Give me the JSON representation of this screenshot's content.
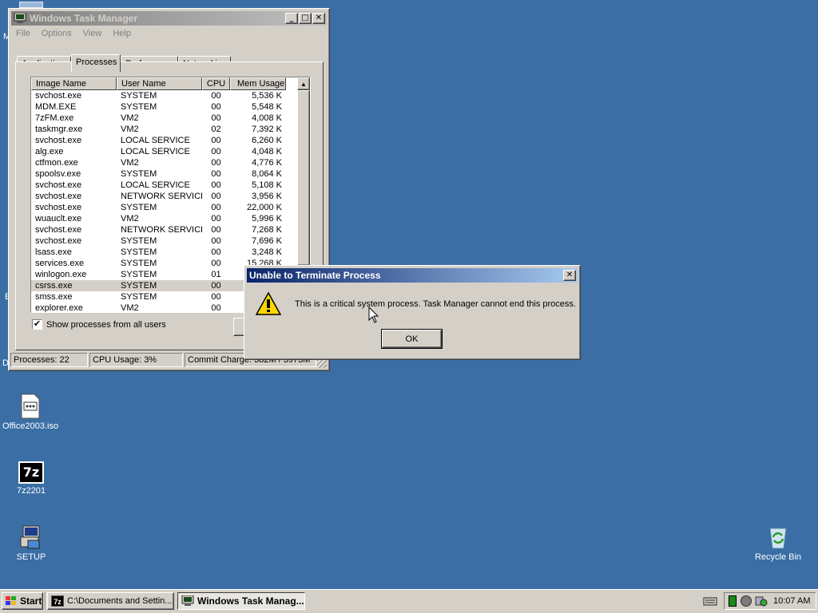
{
  "desktop": {
    "icons": [
      {
        "label": "Office2003.iso",
        "icon": "disc-image-icon"
      },
      {
        "label": "7z2201",
        "icon": "7zip-icon"
      },
      {
        "label": "SETUP",
        "icon": "setup-icon"
      },
      {
        "label": "Recycle Bin",
        "icon": "recycle-bin-icon"
      }
    ],
    "background": "#3a6ea5"
  },
  "task_manager": {
    "title": "Windows Task Manager",
    "menu": [
      "File",
      "Options",
      "View",
      "Help"
    ],
    "tabs": [
      "Applications",
      "Processes",
      "Performance",
      "Networking"
    ],
    "selected_tab": "Processes",
    "columns": [
      "Image Name",
      "User Name",
      "CPU",
      "Mem Usage"
    ],
    "rows": [
      [
        "svchost.exe",
        "SYSTEM",
        "00",
        "5,536 K"
      ],
      [
        "MDM.EXE",
        "SYSTEM",
        "00",
        "5,548 K"
      ],
      [
        "7zFM.exe",
        "VM2",
        "00",
        "4,008 K"
      ],
      [
        "taskmgr.exe",
        "VM2",
        "02",
        "7,392 K"
      ],
      [
        "svchost.exe",
        "LOCAL SERVICE",
        "00",
        "6,260 K"
      ],
      [
        "alg.exe",
        "LOCAL SERVICE",
        "00",
        "4,048 K"
      ],
      [
        "ctfmon.exe",
        "VM2",
        "00",
        "4,776 K"
      ],
      [
        "spoolsv.exe",
        "SYSTEM",
        "00",
        "8,064 K"
      ],
      [
        "svchost.exe",
        "LOCAL SERVICE",
        "00",
        "5,108 K"
      ],
      [
        "svchost.exe",
        "NETWORK SERVICE",
        "00",
        "3,956 K"
      ],
      [
        "svchost.exe",
        "SYSTEM",
        "00",
        "22,000 K"
      ],
      [
        "wuauclt.exe",
        "VM2",
        "00",
        "5,996 K"
      ],
      [
        "svchost.exe",
        "NETWORK SERVICE",
        "00",
        "7,268 K"
      ],
      [
        "svchost.exe",
        "SYSTEM",
        "00",
        "7,696 K"
      ],
      [
        "lsass.exe",
        "SYSTEM",
        "00",
        "3,248 K"
      ],
      [
        "services.exe",
        "SYSTEM",
        "00",
        "15,268 K"
      ],
      [
        "winlogon.exe",
        "SYSTEM",
        "01",
        ""
      ],
      [
        "csrss.exe",
        "SYSTEM",
        "00",
        ""
      ],
      [
        "smss.exe",
        "SYSTEM",
        "00",
        ""
      ],
      [
        "explorer.exe",
        "VM2",
        "00",
        ""
      ]
    ],
    "selected_row": 17,
    "show_all_users_label": "Show processes from all users",
    "show_all_users_checked": true,
    "status": {
      "processes": "Processes: 22",
      "cpu": "CPU Usage: 3%",
      "commit": "Commit Charge: 382M / 3973M"
    }
  },
  "dialog": {
    "title": "Unable to Terminate Process",
    "message": "This is a critical system process.  Task Manager cannot end this process.",
    "ok_label": "OK",
    "icon": "warning-icon"
  },
  "taskbar": {
    "start_label": "Start",
    "buttons": [
      {
        "label": "C:\\Documents and Settin...",
        "icon": "7zip-icon",
        "active": false
      },
      {
        "label": "Windows Task Manag...",
        "icon": "task-manager-icon",
        "active": true
      }
    ],
    "clock": "10:07 AM"
  }
}
